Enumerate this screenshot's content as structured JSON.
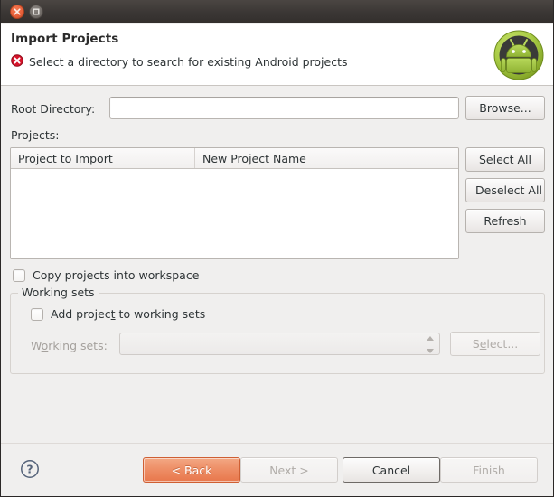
{
  "window": {
    "titlebar": {
      "close_icon": "close-icon",
      "maximize_icon": "maximize-icon"
    }
  },
  "header": {
    "title": "Import Projects",
    "status_icon": "error-icon",
    "status_message": "Select a directory to search for existing Android projects",
    "brand_icon": "android-robot-icon"
  },
  "form": {
    "root_directory_label": "Root Directory:",
    "root_directory_value": "",
    "root_directory_placeholder": "",
    "browse_label": "Browse...",
    "projects_label": "Projects:"
  },
  "table": {
    "columns": [
      "Project to Import",
      "New Project Name"
    ],
    "rows": []
  },
  "side_buttons": {
    "select_all": "Select All",
    "deselect_all": "Deselect All",
    "refresh": "Refresh"
  },
  "options": {
    "copy_projects_label": "Copy projects into workspace",
    "copy_projects_checked": false
  },
  "working_sets": {
    "group_label": "Working sets",
    "add_project_label_pre": "Add projec",
    "add_project_label_mnemonic": "t",
    "add_project_label_post": " to working sets",
    "add_project_checked": false,
    "working_sets_label_pre": "W",
    "working_sets_label_mnemonic": "o",
    "working_sets_label_post": "rking sets:",
    "working_sets_value": "",
    "select_label_pre": "S",
    "select_label_mnemonic": "e",
    "select_label_post": "lect...",
    "enabled": false
  },
  "footer": {
    "help_icon": "help-icon",
    "back_label": "< Back",
    "next_label": "Next >",
    "cancel_label": "Cancel",
    "finish_label": "Finish",
    "back_enabled": true,
    "next_enabled": false,
    "cancel_enabled": true,
    "finish_enabled": false
  },
  "colors": {
    "accent_orange": "#e8774c",
    "titlebar": "#3b3735",
    "body_bg": "#f0efee",
    "header_bg": "#ffffff",
    "error_red": "#cc0000",
    "android_green": "#a4c639"
  }
}
